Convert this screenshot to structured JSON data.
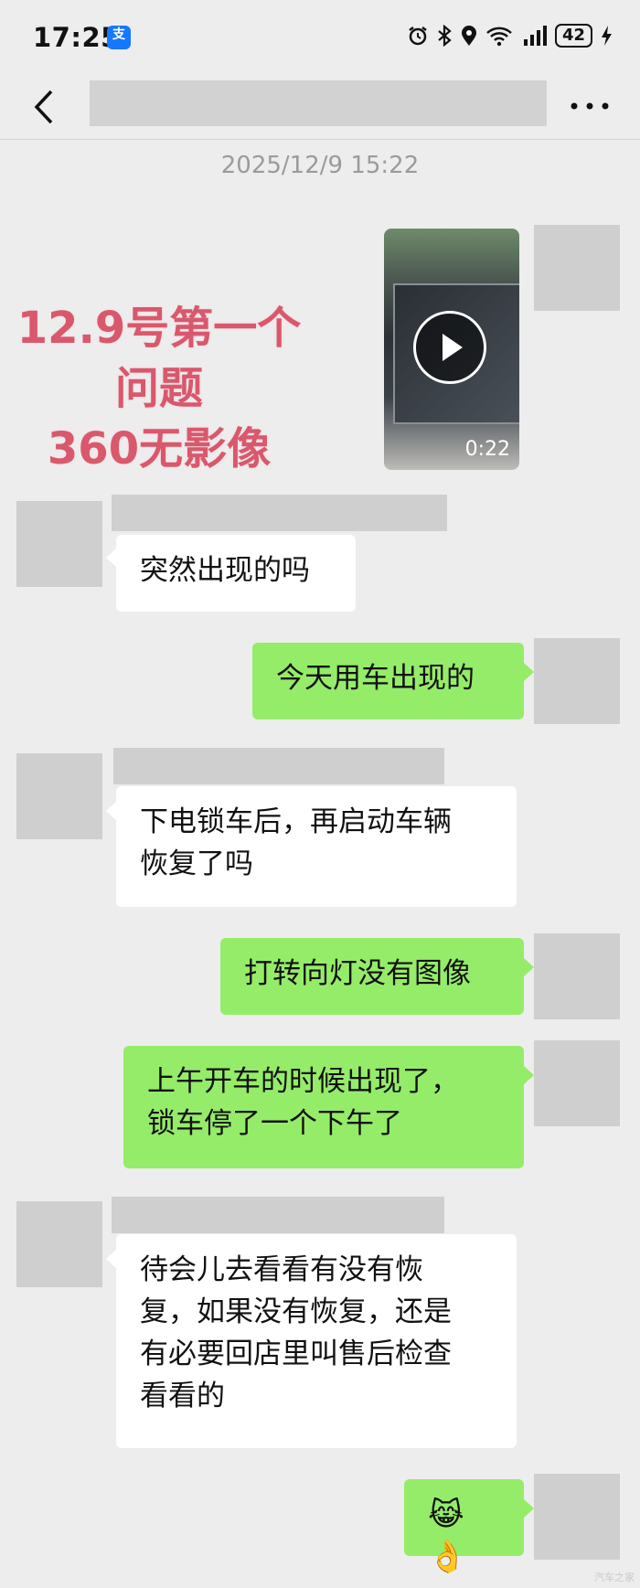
{
  "status_bar": {
    "time": "17:25",
    "app_icon": "支",
    "battery": "42",
    "icons": [
      "alarm-icon",
      "bluetooth-icon",
      "location-icon",
      "wifi-icon",
      "signal-icon",
      "charging-icon"
    ]
  },
  "nav": {
    "back_icon": "chevron-left-icon",
    "more_icon": "ellipsis-icon"
  },
  "timestamp": "2025/12/9 15:22",
  "overlay_text": [
    "12.9号第一个",
    "问题",
    "360无影像"
  ],
  "video": {
    "duration": "0:22"
  },
  "messages": [
    {
      "side": "in",
      "text": "突然出现的吗"
    },
    {
      "side": "out",
      "text": "今天用车出现的"
    },
    {
      "side": "in",
      "lines": [
        "下电锁车后，再启动车辆",
        "恢复了吗"
      ]
    },
    {
      "side": "out",
      "text": "打转向灯没有图像"
    },
    {
      "side": "out",
      "lines": [
        "上午开车的时候出现了，",
        "锁车停了一个下午了"
      ]
    },
    {
      "side": "in",
      "lines": [
        "待会儿去看看有没有恢",
        "复，如果没有恢复，还是",
        "有必要回店里叫售后检查",
        "看看的"
      ]
    },
    {
      "side": "out",
      "text": "😹👌"
    }
  ],
  "watermark": "汽车之家",
  "colors": {
    "outgoing_bubble": "#95ec69",
    "incoming_bubble": "#ffffff",
    "background": "#ededed",
    "overlay_text": "#d9586c"
  }
}
